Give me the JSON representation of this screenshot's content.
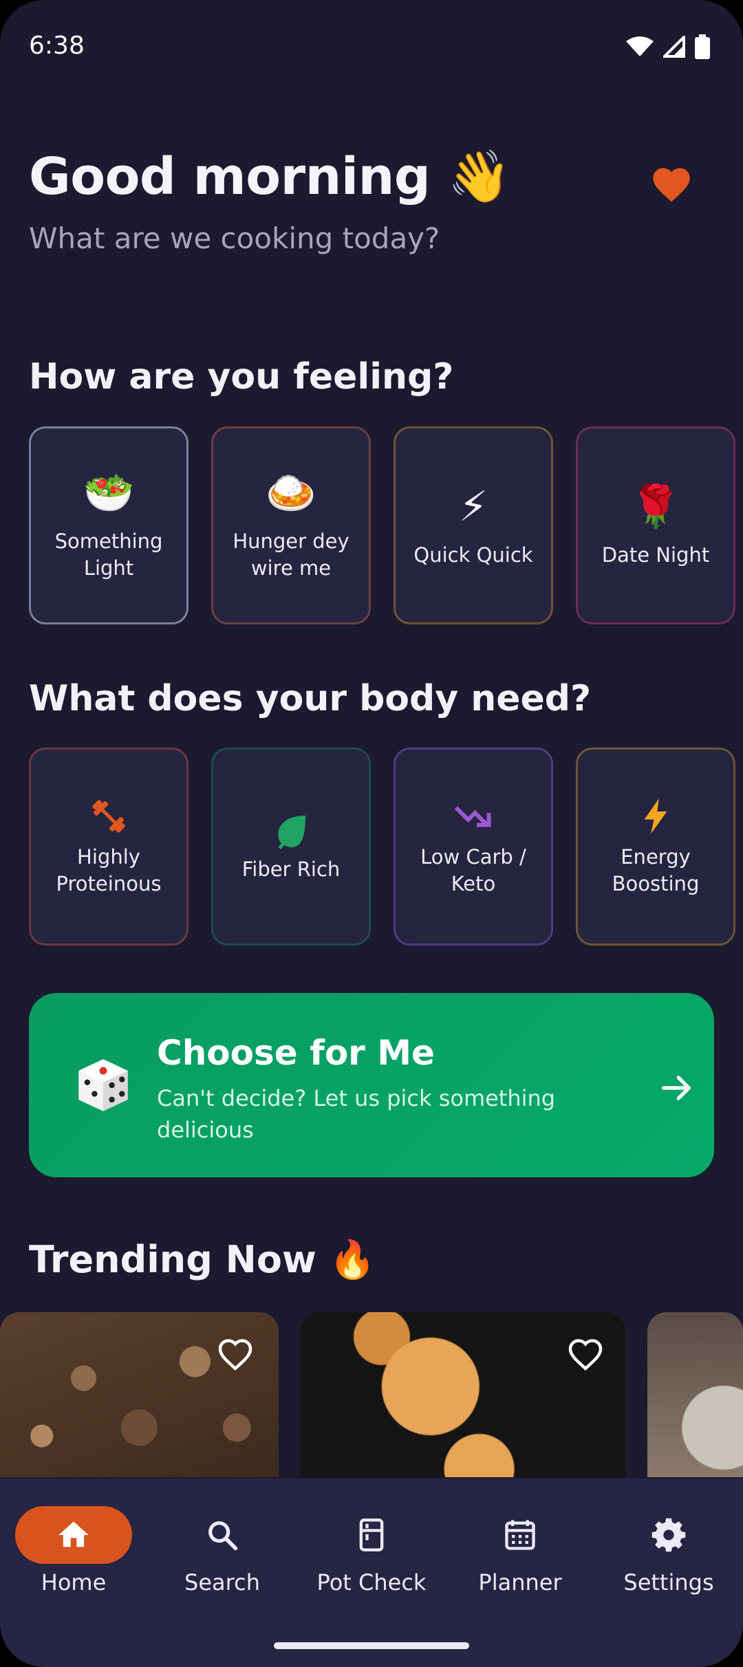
{
  "status_bar": {
    "time": "6:38"
  },
  "header": {
    "greeting": "Good morning",
    "greeting_emoji": "👋",
    "subtitle": "What are we cooking today?",
    "favorite_color": "#e2561f"
  },
  "mood_section": {
    "title": "How are you feeling?",
    "items": [
      {
        "emoji": "🥗",
        "label": "Something\nLight",
        "border": "#7b7f9b",
        "icon": "salad-bowl"
      },
      {
        "emoji": "🍛",
        "label": "Hunger dey\nwire me",
        "border": "#6a3f43",
        "icon": "rice-dish"
      },
      {
        "emoji": "⚡",
        "label": "Quick Quick",
        "border": "#6e5436",
        "icon": "lightning"
      },
      {
        "emoji": "🌹",
        "label": "Date Night",
        "border": "#6a2c55",
        "icon": "rose"
      }
    ]
  },
  "body_section": {
    "title": "What does your body need?",
    "items": [
      {
        "label": "Highly\nProteinous",
        "border": "#6b3540",
        "icon": "dumbbell",
        "color": "#e2561f"
      },
      {
        "label": "Fiber Rich",
        "border": "#1f4b4a",
        "icon": "leaf",
        "color": "#1fa463"
      },
      {
        "label": "Low Carb /\nKeto",
        "border": "#4e3a86",
        "icon": "trending-down",
        "color": "#9b59d0"
      },
      {
        "label": "Energy\nBoosting",
        "border": "#6e5436",
        "icon": "bolt",
        "color": "#f5a623"
      }
    ]
  },
  "choose_card": {
    "title": "Choose for Me",
    "description": "Can't decide? Let us pick something delicious",
    "accent": "#07a063"
  },
  "trending": {
    "title": "Trending Now",
    "title_emoji": "🔥"
  },
  "nav": {
    "items": [
      {
        "label": "Home",
        "icon": "home",
        "active": true
      },
      {
        "label": "Search",
        "icon": "search",
        "active": false
      },
      {
        "label": "Pot Check",
        "icon": "fridge",
        "active": false
      },
      {
        "label": "Planner",
        "icon": "calendar",
        "active": false
      },
      {
        "label": "Settings",
        "icon": "gear",
        "active": false
      }
    ],
    "active_color": "#d9531f"
  }
}
